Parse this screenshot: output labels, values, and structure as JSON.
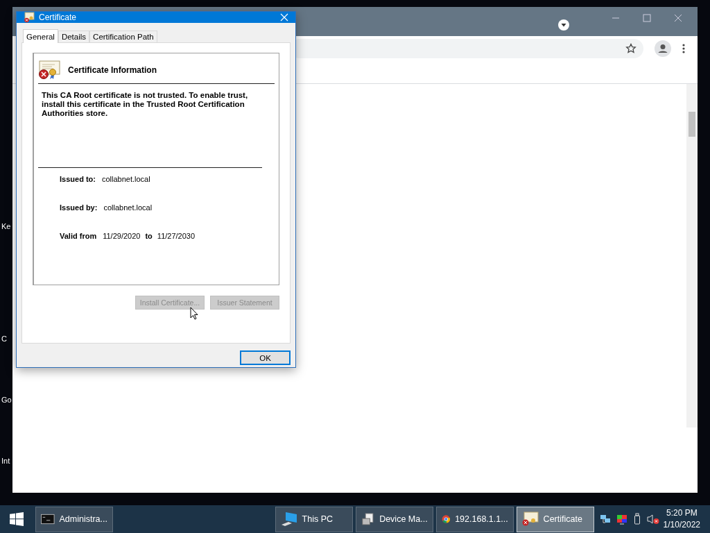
{
  "desktop_icons": [
    {
      "label": "Ke"
    },
    {
      "label": "C"
    },
    {
      "label": "Go"
    },
    {
      "label": "Int"
    }
  ],
  "dialog": {
    "title": "Certificate",
    "tabs": [
      {
        "label": "General",
        "selected": true
      },
      {
        "label": "Details",
        "selected": false
      },
      {
        "label": "Certification Path",
        "selected": false
      }
    ],
    "heading": "Certificate Information",
    "message": "This CA Root certificate is not trusted. To enable trust, install this certificate in the Trusted Root Certification Authorities store.",
    "issued_to": {
      "label": "Issued to:",
      "value": "collabnet.local"
    },
    "issued_by": {
      "label": "Issued by:",
      "value": "collabnet.local"
    },
    "validity": {
      "label": "Valid from",
      "from": "11/29/2020",
      "to_label": "to",
      "to": "11/27/2030"
    },
    "buttons": [
      {
        "label": "Install Certificate...",
        "disabled": true
      },
      {
        "label": "Issuer Statement",
        "disabled": true
      }
    ],
    "ok_button": "OK"
  },
  "taskbar": {
    "items": [
      {
        "label": "Administra...",
        "kind": "console",
        "selected": false
      },
      {
        "label": "This PC",
        "kind": "pc",
        "selected": false
      },
      {
        "label": "Device Ma...",
        "kind": "device",
        "selected": false
      },
      {
        "label": "192.168.1.1...",
        "kind": "browser",
        "selected": false
      },
      {
        "label": "Certificate",
        "kind": "certificate",
        "selected": true
      }
    ],
    "time": "5:20 PM",
    "date": "1/10/2022"
  }
}
